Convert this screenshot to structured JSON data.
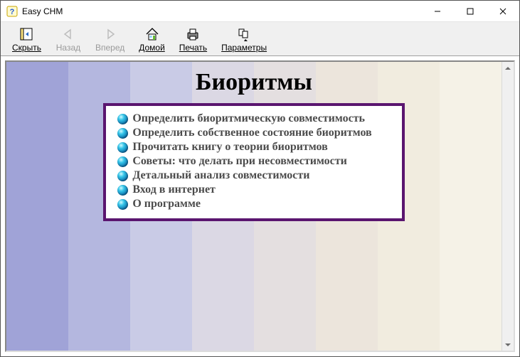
{
  "window": {
    "title": "Easy CHM"
  },
  "toolbar": {
    "hide": {
      "label": "Скрыть"
    },
    "back": {
      "label": "Назад"
    },
    "forward": {
      "label": "Вперед"
    },
    "home": {
      "label": "Домой"
    },
    "print": {
      "label": "Печать"
    },
    "options": {
      "label": "Параметры"
    }
  },
  "page": {
    "heading": "Биоритмы",
    "links": [
      "Определить биоритмическую совместимость",
      "Определить собственное состояние биоритмов",
      "Прочитать книгу о теории биоритмов",
      "Советы: что делать при несовместимости",
      "Детальный анализ совместимости",
      "Вход в интернет",
      "О программе"
    ]
  },
  "colors": {
    "link_box_border": "#5a156f"
  }
}
